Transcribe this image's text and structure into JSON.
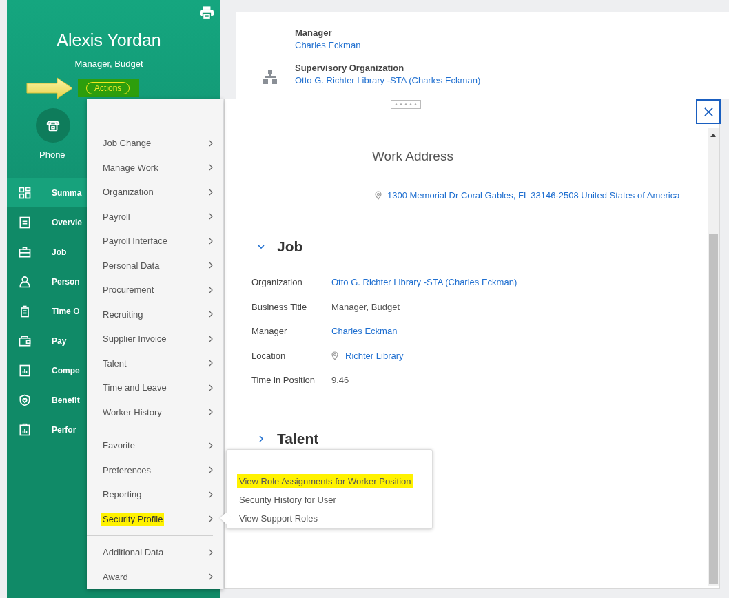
{
  "profile": {
    "name": "Alexis Yordan",
    "title": "Manager, Budget",
    "actions_button": "Actions",
    "contact_label": "Phone"
  },
  "nav": [
    {
      "label": "Summa",
      "selected": true
    },
    {
      "label": "Overvie",
      "selected": false
    },
    {
      "label": "Job",
      "selected": false
    },
    {
      "label": "Person",
      "selected": false
    },
    {
      "label": "Time O",
      "selected": false
    },
    {
      "label": "Pay",
      "selected": false
    },
    {
      "label": "Compe",
      "selected": false
    },
    {
      "label": "Benefit",
      "selected": false
    },
    {
      "label": "Perfor",
      "selected": false
    }
  ],
  "top_card": {
    "fields": [
      {
        "label": "Manager",
        "value": "Charles Eckman"
      },
      {
        "label": "Supervisory Organization",
        "value": "Otto G. Richter Library -STA (Charles Eckman)"
      }
    ]
  },
  "actions_menu": {
    "groups": [
      [
        {
          "label": "Job Change",
          "highlighted": false
        },
        {
          "label": "Manage Work",
          "highlighted": false
        },
        {
          "label": "Organization",
          "highlighted": false
        },
        {
          "label": "Payroll",
          "highlighted": false
        },
        {
          "label": "Payroll Interface",
          "highlighted": false
        },
        {
          "label": "Personal Data",
          "highlighted": false
        },
        {
          "label": "Procurement",
          "highlighted": false
        },
        {
          "label": "Recruiting",
          "highlighted": false
        },
        {
          "label": "Supplier Invoice",
          "highlighted": false
        },
        {
          "label": "Talent",
          "highlighted": false
        },
        {
          "label": "Time and Leave",
          "highlighted": false
        },
        {
          "label": "Worker History",
          "highlighted": false
        }
      ],
      [
        {
          "label": "Favorite",
          "highlighted": false
        },
        {
          "label": "Preferences",
          "highlighted": false
        },
        {
          "label": "Reporting",
          "highlighted": false
        },
        {
          "label": "Security Profile",
          "highlighted": true
        }
      ],
      [
        {
          "label": "Additional Data",
          "highlighted": false
        },
        {
          "label": "Award",
          "highlighted": false
        }
      ]
    ]
  },
  "submenu": {
    "items": [
      {
        "label": "View Role Assignments for Worker Position",
        "highlighted": true
      },
      {
        "label": "Security History for User",
        "highlighted": false
      },
      {
        "label": "View Support Roles",
        "highlighted": false
      }
    ]
  },
  "panel": {
    "work_address": {
      "title": "Work Address",
      "address": "1300 Memorial Dr Coral Gables, FL 33146-2508 United States of America"
    },
    "sections": [
      {
        "title": "Job",
        "expanded": true,
        "fields": [
          {
            "label": "Organization",
            "value": "Otto G. Richter Library -STA (Charles Eckman)",
            "kind": "link"
          },
          {
            "label": "Business Title",
            "value": "Manager, Budget",
            "kind": "text"
          },
          {
            "label": "Manager",
            "value": "Charles Eckman",
            "kind": "link"
          },
          {
            "label": "Location",
            "value": "Richter Library",
            "kind": "location"
          },
          {
            "label": "Time in Position",
            "value": "9.46",
            "kind": "text"
          }
        ]
      },
      {
        "title": "Talent",
        "expanded": false
      }
    ]
  }
}
